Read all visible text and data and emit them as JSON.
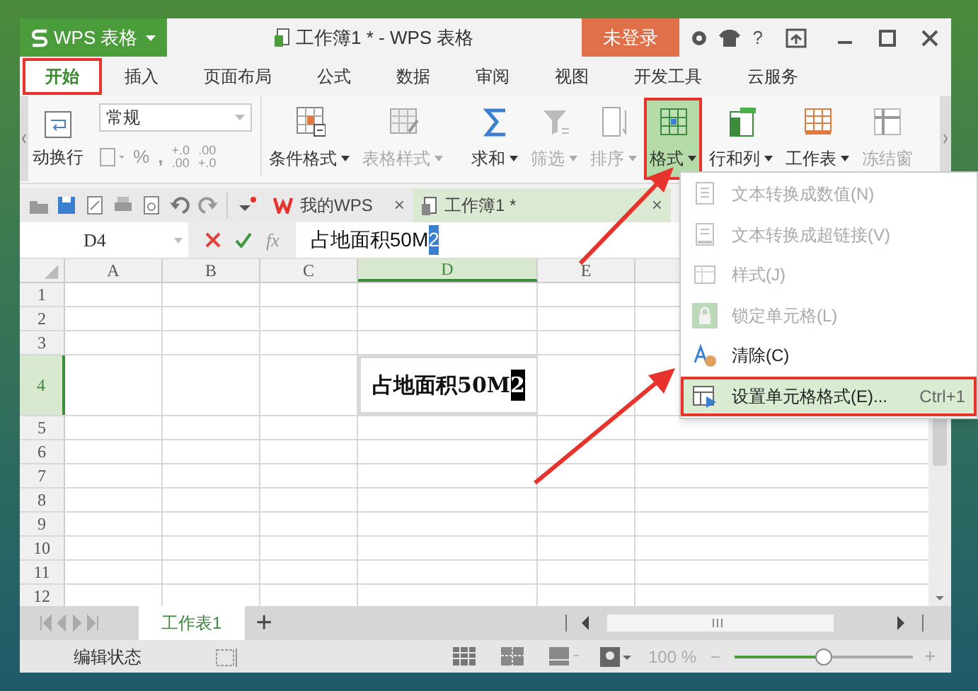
{
  "title_bar": {
    "app_menu": "WPS 表格",
    "document_title": "工作簿1 * - WPS 表格",
    "login_button": "未登录",
    "help": "?"
  },
  "ribbon_tabs": [
    {
      "label": "开始",
      "selected": true,
      "highlighted": true
    },
    {
      "label": "插入",
      "selected": false,
      "highlighted": false
    },
    {
      "label": "页面布局",
      "selected": false,
      "highlighted": false
    },
    {
      "label": "公式",
      "selected": false,
      "highlighted": false
    },
    {
      "label": "数据",
      "selected": false,
      "highlighted": false
    },
    {
      "label": "审阅",
      "selected": false,
      "highlighted": false
    },
    {
      "label": "视图",
      "selected": false,
      "highlighted": false
    },
    {
      "label": "开发工具",
      "selected": false,
      "highlighted": false
    },
    {
      "label": "云服务",
      "selected": false,
      "highlighted": false
    }
  ],
  "ribbon": {
    "wrap_label": "动换行",
    "number_format": "常规",
    "percent": "%",
    "comma": ",",
    "decimal_buttons": [
      {
        "top": "+.0",
        "bottom": ".00"
      },
      {
        "top": ".00",
        "bottom": "+.0"
      }
    ],
    "commands": [
      {
        "kind": "conditional",
        "label": "条件格式",
        "disabled": false,
        "selected": false,
        "highlighted": false
      },
      {
        "kind": "table_style",
        "label": "表格样式",
        "disabled": true,
        "selected": false,
        "highlighted": false
      },
      {
        "kind": "sum",
        "label": "求和",
        "disabled": false,
        "selected": false,
        "highlighted": false
      },
      {
        "kind": "filter",
        "label": "筛选",
        "disabled": true,
        "selected": false,
        "highlighted": false
      },
      {
        "kind": "sort",
        "label": "排序",
        "disabled": true,
        "selected": false,
        "highlighted": false
      },
      {
        "kind": "format",
        "label": "格式",
        "disabled": false,
        "selected": true,
        "highlighted": true
      },
      {
        "kind": "rowcol",
        "label": "行和列",
        "disabled": false,
        "selected": false,
        "highlighted": false
      },
      {
        "kind": "sheet",
        "label": "工作表",
        "disabled": false,
        "selected": false,
        "highlighted": false
      },
      {
        "kind": "freeze",
        "label": "冻结窗",
        "disabled": true,
        "selected": false,
        "highlighted": false
      }
    ]
  },
  "doc_tabs": [
    {
      "kind": "home",
      "label": "我的WPS",
      "selected": false,
      "close": "×"
    },
    {
      "kind": "workbook",
      "label": "工作簿1 *",
      "selected": true,
      "close": "×"
    }
  ],
  "formula_bar": {
    "name_box": "D4",
    "fx": "fx",
    "content": "占地面积50M",
    "content_selected": "2"
  },
  "grid": {
    "columns": [
      {
        "label": "A",
        "selected": false
      },
      {
        "label": "B",
        "selected": false
      },
      {
        "label": "C",
        "selected": false
      },
      {
        "label": "D",
        "selected": true
      },
      {
        "label": "E",
        "selected": false
      }
    ],
    "rows": [
      {
        "label": "1",
        "selected": false
      },
      {
        "label": "2",
        "selected": false
      },
      {
        "label": "3",
        "selected": false
      },
      {
        "label": "4",
        "selected": true,
        "cells": [
          null,
          null,
          null,
          {
            "text": "占地面积50M",
            "selected_text": "2"
          },
          null
        ]
      },
      {
        "label": "5",
        "selected": false
      },
      {
        "label": "6",
        "selected": false
      },
      {
        "label": "7",
        "selected": false
      },
      {
        "label": "8",
        "selected": false
      },
      {
        "label": "9",
        "selected": false
      },
      {
        "label": "10",
        "selected": false
      },
      {
        "label": "11",
        "selected": false
      },
      {
        "label": "12",
        "selected": false
      }
    ]
  },
  "format_menu": [
    {
      "kind": "to_number",
      "label": "文本转换成数值(N)",
      "disabled": true,
      "selected": false,
      "highlighted": false
    },
    {
      "kind": "to_link",
      "label": "文本转换成超链接(V)",
      "disabled": true,
      "selected": false,
      "highlighted": false
    },
    {
      "kind": "style",
      "label": "样式(J)",
      "disabled": true,
      "selected": false,
      "highlighted": false
    },
    {
      "kind": "lock",
      "label": "锁定单元格(L)",
      "disabled": true,
      "selected": false,
      "highlighted": false
    },
    {
      "kind": "clear",
      "label": "清除(C)",
      "disabled": false,
      "selected": false,
      "highlighted": false
    },
    {
      "kind": "format_cells",
      "label": "设置单元格格式(E)...",
      "shortcut": "Ctrl+1",
      "disabled": false,
      "selected": true,
      "highlighted": true
    }
  ],
  "sheet_tabs": [
    {
      "label": "工作表1",
      "selected": true
    }
  ],
  "add_sheet": "+",
  "status_bar": {
    "mode": "编辑状态",
    "zoom": "100 %",
    "zoom_out": "−",
    "zoom_in": "+",
    "zoom_slider": {
      "level": 0.5
    }
  }
}
